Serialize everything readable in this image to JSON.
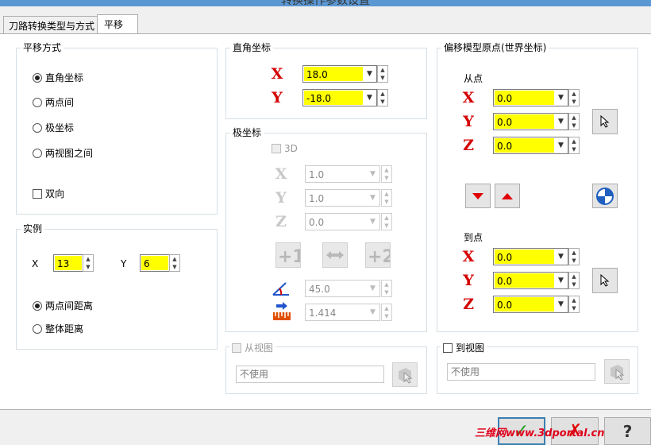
{
  "window": {
    "title": "转换操作参数设置"
  },
  "tabs": [
    "刀路转换类型与方式",
    "平移"
  ],
  "move_mode": {
    "title": "平移方式",
    "options": [
      "直角坐标",
      "两点间",
      "极坐标",
      "两视图之间"
    ],
    "selected": "直角坐标",
    "bidirectional_label": "双向"
  },
  "instances": {
    "title": "实例",
    "x_label": "X",
    "x_value": "13",
    "y_label": "Y",
    "y_value": "6",
    "options": [
      "两点间距离",
      "整体距离"
    ],
    "selected": "两点间距离"
  },
  "rect_coords": {
    "title": "直角坐标",
    "axis_x": "X",
    "axis_y": "Y",
    "x_value": "18.0",
    "y_value": "-18.0"
  },
  "polar": {
    "title": "极坐标",
    "check_3d": "3D",
    "axis_x": "X",
    "axis_y": "Y",
    "axis_z": "Z",
    "x_value": "1.0",
    "y_value": "1.0",
    "z_value": "0.0",
    "angle_value": "45.0",
    "distance_value": "1.414"
  },
  "offset": {
    "title": "偏移模型原点(世界坐标)",
    "from_label": "从点",
    "to_label": "到点",
    "axis_x": "X",
    "axis_y": "Y",
    "axis_z": "Z",
    "from": {
      "x": "0.0",
      "y": "0.0",
      "z": "0.0"
    },
    "to": {
      "x": "0.0",
      "y": "0.0",
      "z": "0.0"
    }
  },
  "from_view": {
    "label": "从视图",
    "value": "不使用"
  },
  "to_view": {
    "label": "到视图",
    "value": "不使用"
  },
  "buttons": {
    "ok": "✓",
    "cancel": "✗",
    "help": "?"
  },
  "watermark": "三维网www.3dportal.cn",
  "colors": {
    "highlight": "#ffff00",
    "axis": "#d40000",
    "arrow": "#e00000"
  }
}
